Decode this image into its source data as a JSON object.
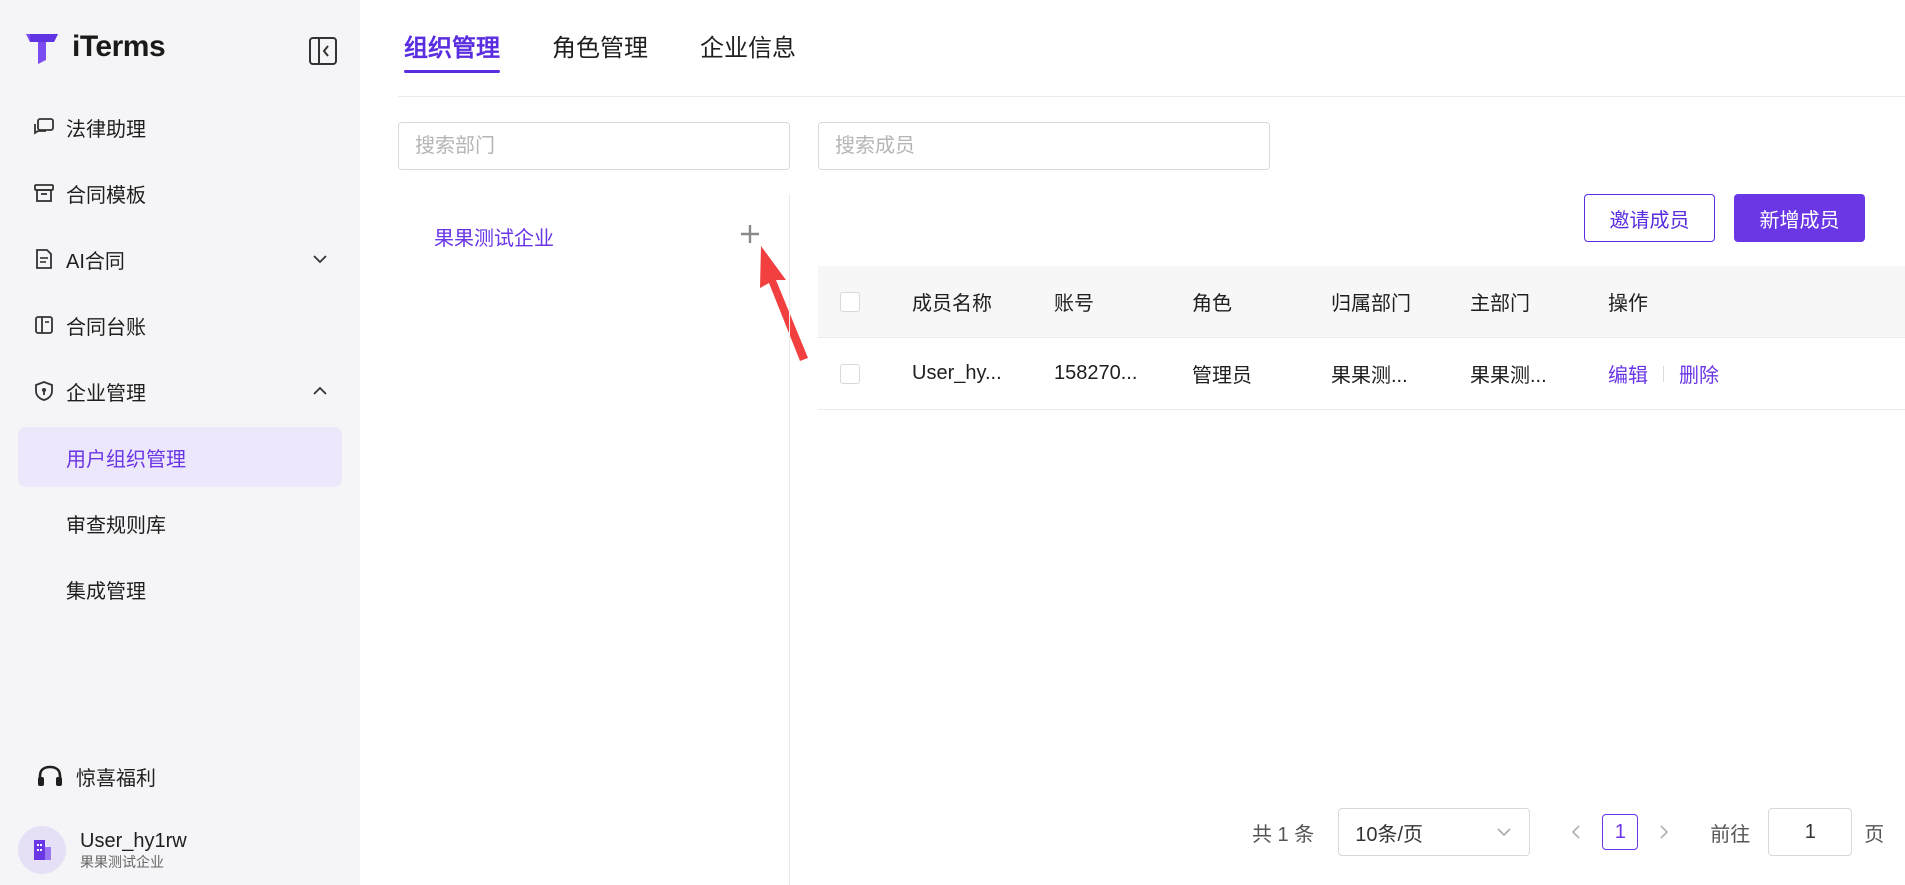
{
  "brand": {
    "name": "iTerms",
    "accent": "#6a36e6"
  },
  "sidebar": {
    "items": [
      {
        "label": "法律助理",
        "icon": "chat-icon"
      },
      {
        "label": "合同模板",
        "icon": "archive-box-icon"
      },
      {
        "label": "AI合同",
        "icon": "document-icon"
      },
      {
        "label": "合同台账",
        "icon": "ledger-icon"
      },
      {
        "label": "企业管理",
        "icon": "shield-icon"
      }
    ],
    "subitems": [
      {
        "label": "用户组织管理",
        "active": true
      },
      {
        "label": "审查规则库",
        "active": false
      },
      {
        "label": "集成管理",
        "active": false
      }
    ],
    "promo_label": "惊喜福利",
    "user": {
      "name": "User_hy1rw",
      "org": "果果测试企业"
    }
  },
  "tabs": [
    {
      "label": "组织管理",
      "active": true
    },
    {
      "label": "角色管理",
      "active": false
    },
    {
      "label": "企业信息",
      "active": false
    }
  ],
  "dept_search": {
    "placeholder": "搜索部门",
    "value": ""
  },
  "member_search": {
    "placeholder": "搜索成员",
    "value": ""
  },
  "tree": {
    "root_label": "果果测试企业"
  },
  "buttons": {
    "invite": "邀请成员",
    "add": "新增成员"
  },
  "table": {
    "columns": [
      "成员名称",
      "账号",
      "角色",
      "归属部门",
      "主部门",
      "操作"
    ],
    "rows": [
      {
        "name": "User_hy...",
        "account": "158270...",
        "role": "管理员",
        "dept": "果果测...",
        "main_dept": "果果测...",
        "edit": "编辑",
        "delete": "删除"
      }
    ]
  },
  "pagination": {
    "total_text": "共 1 条",
    "page_size": "10条/页",
    "current_page": "1",
    "goto_label": "前往",
    "goto_value": "1",
    "page_suffix": "页"
  }
}
